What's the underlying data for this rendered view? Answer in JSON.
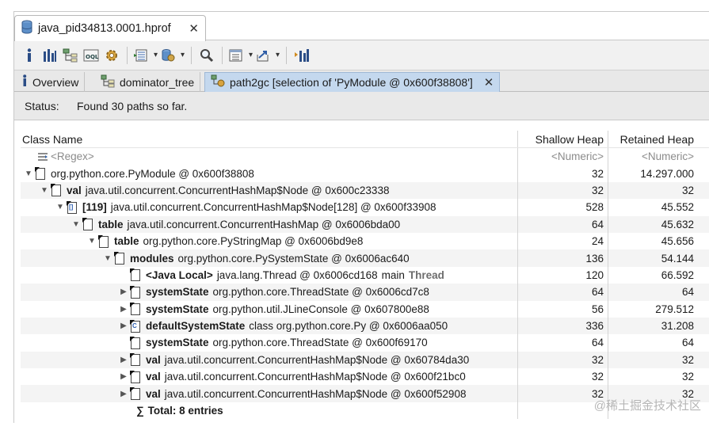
{
  "editor_tab": {
    "title": "java_pid34813.0001.hprof"
  },
  "view_tabs": [
    {
      "label": "Overview"
    },
    {
      "label": "dominator_tree"
    },
    {
      "label": "path2gc [selection of 'PyModule @ 0x600f38808']"
    }
  ],
  "status": {
    "label": "Status:",
    "text": "Found 30 paths so far."
  },
  "table": {
    "headers": {
      "name": "Class Name",
      "shallow": "Shallow Heap",
      "retained": "Retained Heap"
    },
    "filter": {
      "name": "<Regex>",
      "shallow": "<Numeric>",
      "retained": "<Numeric>"
    },
    "rows": [
      {
        "indent": 0,
        "twisty": "▼",
        "icon": "object-icon",
        "field": "",
        "cls": "org.python.core.PyModule @ 0x600f38808",
        "extra": "",
        "extra2": "",
        "shallow": "32",
        "retained": "14.297.000"
      },
      {
        "indent": 1,
        "twisty": "▼",
        "icon": "object-icon",
        "field": "val",
        "cls": "java.util.concurrent.ConcurrentHashMap$Node @ 0x600c23338",
        "extra": "",
        "extra2": "",
        "shallow": "32",
        "retained": "32"
      },
      {
        "indent": 2,
        "twisty": "▼",
        "icon": "array-icon",
        "field": "[119]",
        "cls": "java.util.concurrent.ConcurrentHashMap$Node[128] @ 0x600f33908",
        "extra": "",
        "extra2": "",
        "shallow": "528",
        "retained": "45.552"
      },
      {
        "indent": 3,
        "twisty": "▼",
        "icon": "object-icon",
        "field": "table",
        "cls": "java.util.concurrent.ConcurrentHashMap @ 0x6006bda00",
        "extra": "",
        "extra2": "",
        "shallow": "64",
        "retained": "45.632"
      },
      {
        "indent": 4,
        "twisty": "▼",
        "icon": "object-icon",
        "field": "table",
        "cls": "org.python.core.PyStringMap @ 0x6006bd9e8",
        "extra": "",
        "extra2": "",
        "shallow": "24",
        "retained": "45.656"
      },
      {
        "indent": 5,
        "twisty": "▼",
        "icon": "object-icon",
        "field": "modules",
        "cls": "org.python.core.PySystemState @ 0x6006ac640",
        "extra": "",
        "extra2": "",
        "shallow": "136",
        "retained": "54.144"
      },
      {
        "indent": 6,
        "twisty": "",
        "icon": "object-icon",
        "field": "<Java Local>",
        "cls": "java.lang.Thread @ 0x6006cd168",
        "extra": "main",
        "extra2": "Thread",
        "shallow": "120",
        "retained": "66.592"
      },
      {
        "indent": 6,
        "twisty": "▶",
        "icon": "object-icon",
        "field": "systemState",
        "cls": "org.python.core.ThreadState @ 0x6006cd7c8",
        "extra": "",
        "extra2": "",
        "shallow": "64",
        "retained": "64"
      },
      {
        "indent": 6,
        "twisty": "▶",
        "icon": "object-icon",
        "field": "systemState",
        "cls": "org.python.util.JLineConsole @ 0x607800e88",
        "extra": "",
        "extra2": "",
        "shallow": "56",
        "retained": "279.512"
      },
      {
        "indent": 6,
        "twisty": "▶",
        "icon": "class-icon",
        "field": "defaultSystemState",
        "cls": "class org.python.core.Py @ 0x6006aa050",
        "extra": "",
        "extra2": "",
        "shallow": "336",
        "retained": "31.208"
      },
      {
        "indent": 6,
        "twisty": "",
        "icon": "object-icon",
        "field": "systemState",
        "cls": "org.python.core.ThreadState @ 0x600f69170",
        "extra": "",
        "extra2": "",
        "shallow": "64",
        "retained": "64"
      },
      {
        "indent": 6,
        "twisty": "▶",
        "icon": "object-icon",
        "field": "val",
        "cls": "java.util.concurrent.ConcurrentHashMap$Node @ 0x60784da30",
        "extra": "",
        "extra2": "",
        "shallow": "32",
        "retained": "32"
      },
      {
        "indent": 6,
        "twisty": "▶",
        "icon": "object-icon",
        "field": "val",
        "cls": "java.util.concurrent.ConcurrentHashMap$Node @ 0x600f21bc0",
        "extra": "",
        "extra2": "",
        "shallow": "32",
        "retained": "32"
      },
      {
        "indent": 6,
        "twisty": "▶",
        "icon": "object-icon",
        "field": "val",
        "cls": "java.util.concurrent.ConcurrentHashMap$Node @ 0x600f52908",
        "extra": "",
        "extra2": "",
        "shallow": "32",
        "retained": "32"
      }
    ],
    "total": "Total: 8 entries"
  },
  "watermark": "@稀土掘金技术社区"
}
